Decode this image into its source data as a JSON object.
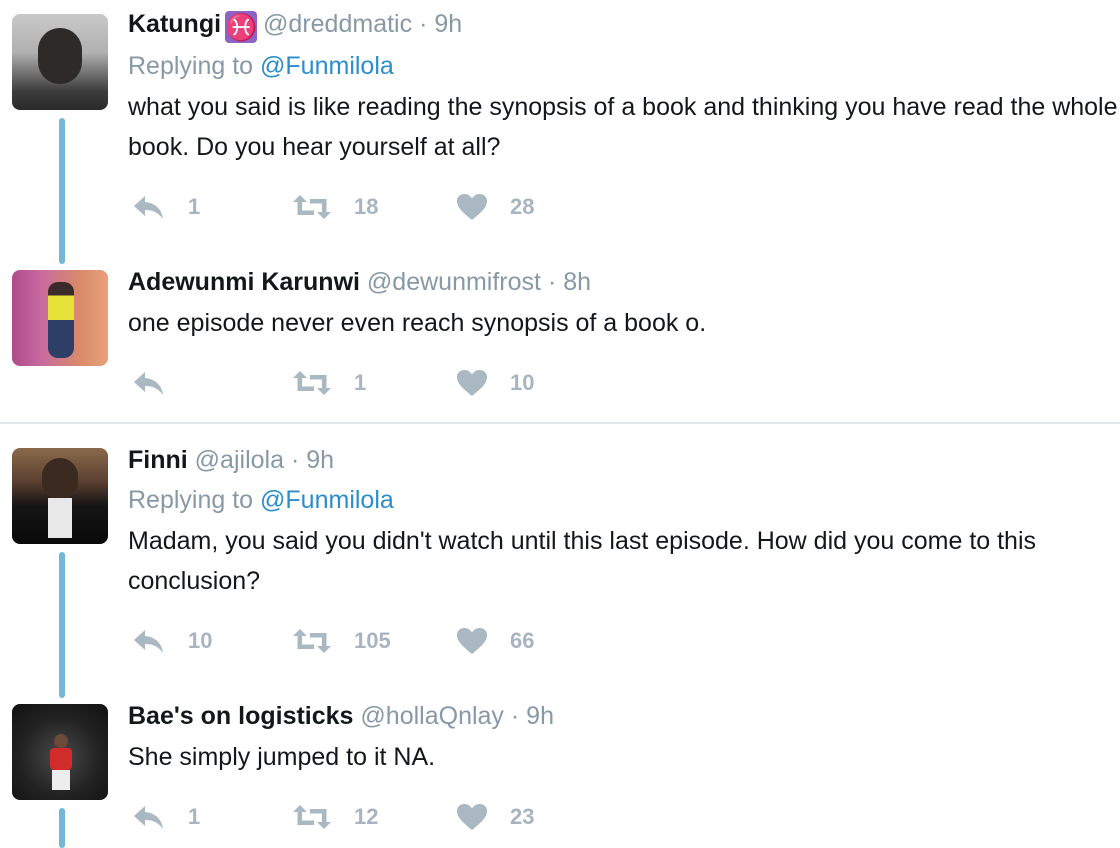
{
  "tweets": [
    {
      "name": "Katungi",
      "zodiac": "♓",
      "handle": "@dreddmatic",
      "time": "· 9h",
      "replying_prefix": "Replying to",
      "replying_mention": "@Funmilola",
      "text": "what you said is like reading the synopsis of a book and thinking you have read the whole book. Do you hear yourself at all?",
      "reply_count": "1",
      "retweet_count": "18",
      "like_count": "28"
    },
    {
      "name": "Adewunmi Karunwi",
      "handle": "@dewunmifrost",
      "time": "· 8h",
      "text": "one episode never even reach synopsis of a book o.",
      "reply_count": "",
      "retweet_count": "1",
      "like_count": "10"
    },
    {
      "name": "Finni",
      "handle": "@ajilola",
      "time": "· 9h",
      "replying_prefix": "Replying to",
      "replying_mention": "@Funmilola",
      "text": "Madam, you said you didn't watch until this last episode. How did you come to this conclusion?",
      "reply_count": "10",
      "retweet_count": "105",
      "like_count": "66"
    },
    {
      "name": "Bae's on logisticks",
      "handle": "@hollaQnlay",
      "time": "· 9h",
      "text": "She simply jumped to it NA.",
      "reply_count": "1",
      "retweet_count": "12",
      "like_count": "23"
    }
  ],
  "icons": {
    "reply": "reply-icon",
    "retweet": "retweet-icon",
    "like": "heart-icon"
  },
  "colors": {
    "thread_line": "#74b8d8",
    "mention": "#2b8dcc",
    "action_gray": "#a8b5c0",
    "zodiac_bg": "#8f63c3"
  }
}
